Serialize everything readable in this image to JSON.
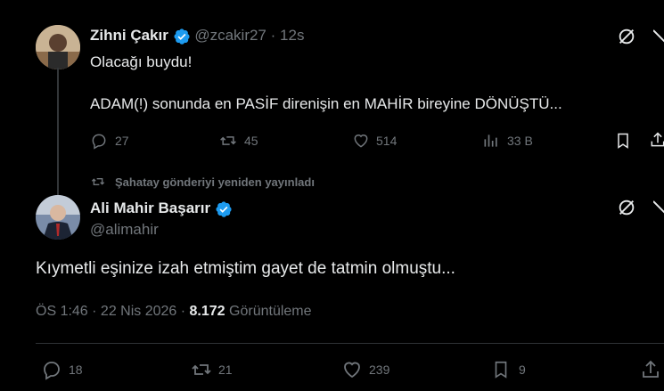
{
  "quoted_tweet": {
    "display_name": "Zihni Çakır",
    "handle": "@zcakir27",
    "separator": "·",
    "time": "12s",
    "text_line1": "Olacağı buydu!",
    "text_line2": "ADAM(!) sonunda en PASİF direnişin en MAHİR bireyine DÖNÜŞTÜ...",
    "replies": "27",
    "reposts": "45",
    "likes": "514",
    "views": "33 B"
  },
  "repost_banner": {
    "text": "Şahatay gönderiyi yeniden yayınladı"
  },
  "main_tweet": {
    "display_name": "Ali Mahir Başarır",
    "handle": "@alimahir",
    "text": "Kıymetli eşinize izah etmiştim gayet de tatmin olmuştu...",
    "timestamp": "ÖS 1:46 · 22 Nis 2026 · ",
    "views_count": "8.172",
    "views_label": " Görüntüleme",
    "replies": "18",
    "reposts": "21",
    "likes": "239",
    "bookmarks": "9"
  },
  "colors": {
    "background": "#000000",
    "text": "#e7e9ea",
    "muted": "#71767b",
    "verified": "#1d9bf0",
    "divider": "#2f3336"
  }
}
